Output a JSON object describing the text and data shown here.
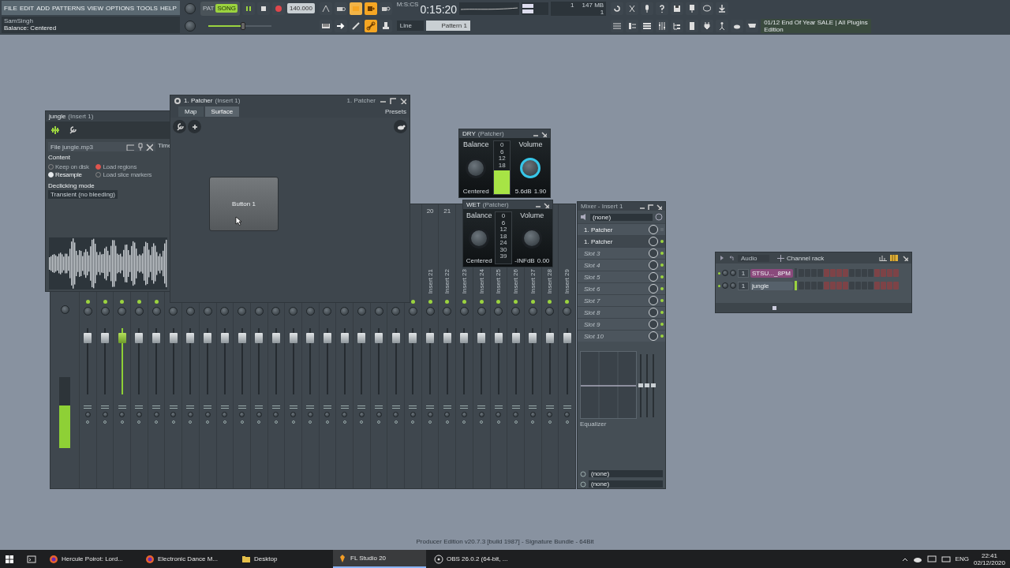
{
  "toolbar": {
    "menu": [
      "FILE",
      "EDIT",
      "ADD",
      "PATTERNS",
      "VIEW",
      "OPTIONS",
      "TOOLS",
      "HELP"
    ],
    "hint": {
      "title": "SamSingh",
      "text": "Balance: Centered"
    },
    "mode_top": "PAT",
    "mode": "SONG",
    "song_mode": true,
    "tempo": "140.000",
    "time": "0:15:20",
    "time_unit": "M:S:CS",
    "memory": "147 MB",
    "cpu": "1",
    "polyphony": "1",
    "snap": "Line",
    "pattern": "Pattern 1",
    "news": "01/12  End Of Year SALE | All Plugins Edition",
    "master_pitch": {
      "level": 0.55
    }
  },
  "sampler": {
    "title": "jungle",
    "subtitle": "(Insert 1)",
    "file_label": "File",
    "file_value": "jungle.mp3",
    "section": "Content",
    "side_label": "Time",
    "options": [
      {
        "label": "Keep on disk",
        "selected": false,
        "disabled": true
      },
      {
        "label": "Load regions",
        "selected": true,
        "disabled": true
      },
      {
        "label": "Resample",
        "selected": true,
        "disabled": false
      },
      {
        "label": "Load slice markers",
        "selected": false,
        "disabled": true
      }
    ],
    "declick_label": "Declicking mode",
    "declick_value": "Transient (no bleeding)"
  },
  "patcher": {
    "title": "1. Patcher",
    "subtitle": "(Insert 1)",
    "preset": "1. Patcher",
    "tabs": [
      {
        "label": "Map",
        "selected": false
      },
      {
        "label": "Surface",
        "selected": true
      }
    ],
    "presets": "Presets",
    "surface_button": "Button 1"
  },
  "panels": [
    {
      "title": "DRY",
      "subtitle": "(Patcher)",
      "balance_label": "Balance",
      "volume_label": "Volume",
      "balance_value": "Centered",
      "volume_db": "5.6dB",
      "volume_value": "1.90",
      "level": 0.45,
      "focused": true,
      "scale": [
        "0",
        "6",
        "12",
        "18"
      ]
    },
    {
      "title": "WET",
      "subtitle": "(Patcher)",
      "balance_label": "Balance",
      "volume_label": "Volume",
      "balance_value": "Centered",
      "volume_db": "-INFdB",
      "volume_value": "0.00",
      "level": 0,
      "focused": false,
      "scale": [
        "0",
        "6",
        "12",
        "18",
        "24",
        "30",
        "39"
      ]
    }
  ],
  "mixer": {
    "header_numbers": [
      "20",
      "21"
    ],
    "insert_labels": [
      "Insert 21",
      "Insert 22",
      "Insert 23",
      "Insert 24",
      "Insert 25",
      "Insert 26",
      "Insert 27",
      "Insert 28",
      "Insert 29"
    ],
    "master": {
      "level": 0.6
    }
  },
  "mixer_insert": {
    "title": "Mixer - Insert 1",
    "input": "(none)",
    "slots": [
      {
        "label": "1. Patcher",
        "kind": "effect",
        "on": false,
        "selected": false
      },
      {
        "label": "1. Patcher",
        "kind": "effect",
        "on": true,
        "selected": true
      },
      {
        "label": "Slot 3",
        "kind": "empty",
        "on": true,
        "selected": false
      },
      {
        "label": "Slot 4",
        "kind": "empty",
        "on": true,
        "selected": false
      },
      {
        "label": "Slot 5",
        "kind": "empty",
        "on": true,
        "selected": false
      },
      {
        "label": "Slot 6",
        "kind": "empty",
        "on": true,
        "selected": false
      },
      {
        "label": "Slot 7",
        "kind": "empty",
        "on": true,
        "selected": false
      },
      {
        "label": "Slot 8",
        "kind": "empty",
        "on": true,
        "selected": false
      },
      {
        "label": "Slot 9",
        "kind": "empty",
        "on": true,
        "selected": false
      },
      {
        "label": "Slot 10",
        "kind": "empty",
        "on": true,
        "selected": false
      }
    ],
    "eq_sliders": [
      {
        "level": 0.5
      },
      {
        "level": 0.5
      },
      {
        "level": 0.5
      }
    ],
    "eq_label": "Equalizer",
    "outputs": [
      "(none)",
      "(none)"
    ]
  },
  "channel_rack": {
    "title": "Channel rack",
    "filter": "Audio",
    "channels": [
      {
        "number": "1",
        "name": "STSU..._8PM",
        "color": "#8a4a7c",
        "selected": false
      },
      {
        "number": "1",
        "name": "jungle",
        "color": "#56616b",
        "selected": true
      }
    ]
  },
  "footer": "Producer Edition v20.7.3 [build 1987] - Signature Bundle - 64Bit",
  "taskbar": {
    "items": [
      {
        "label": "Hercule Poirot: Lord...",
        "selected": false
      },
      {
        "label": "Electronic Dance M...",
        "selected": false
      },
      {
        "label": "Desktop",
        "selected": false
      },
      {
        "label": "FL Studio 20",
        "selected": true
      },
      {
        "label": "OBS 26.0.2 (64-bit, ...",
        "selected": false
      }
    ],
    "language": "ENG",
    "time": "22:41",
    "date": "02/12/2020"
  }
}
